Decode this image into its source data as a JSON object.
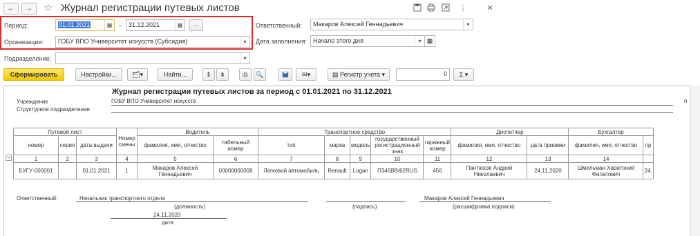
{
  "window": {
    "title": "Журнал регистрации путевых листов",
    "back_icon": "←",
    "forward_icon": "→",
    "star_icon": "☆",
    "top_icons": [
      "save-icon",
      "print-icon",
      "link-icon",
      "more-icon",
      "close-icon"
    ]
  },
  "filters": {
    "period_label": "Период:",
    "period_from": "01.01.2021",
    "period_dash": "–",
    "period_to": "31.12.2021",
    "period_more": "...",
    "org_label": "Организация:",
    "org_value": "ГОБУ ВПО Университет искусств (Субсидия)",
    "dept_label": "Подразделение:",
    "dept_value": "",
    "responsible_label": "Ответственный:",
    "responsible_value": "Макаров Алексей Геннадьевич",
    "fill_date_label": "Дата заполнения:",
    "fill_date_value": "Начало этого дня"
  },
  "toolbar": {
    "generate": "Сформировать",
    "settings": "Настройки...",
    "find": "Найти...",
    "registry": "Регистр учета",
    "number_value": "0",
    "sum_icon": "Σ"
  },
  "report": {
    "heading": "Журнал регистрации путевых листов за период с 01.01.2021 по 31.12.2021",
    "institution_label": "Учреждение",
    "institution_value": "ГОБУ ВПО Университет искусств",
    "structural_label": "Структурное подразделение",
    "right_edge_text": "п",
    "group_headers": [
      "Путевой лист",
      "Номер смены",
      "Водитель",
      "Транспортное средство",
      "Диспетчер",
      "Бухгалтер"
    ],
    "columns": [
      "номер",
      "серия",
      "дата выдачи",
      "",
      "фамилия, имя, отчество",
      "табельный номер",
      "тип",
      "марка",
      "модель",
      "государственный регистрационный знак",
      "гаражный номер",
      "фамилия, имя, отчество",
      "дата приемки",
      "фамилия, имя, отчество",
      "пр"
    ],
    "column_numbers": [
      "1",
      "2",
      "3",
      "4",
      "5",
      "6",
      "7",
      "8",
      "9",
      "10",
      "11",
      "12",
      "13",
      "14",
      ""
    ],
    "rows": [
      [
        "БУГУ-000001",
        "",
        "01.01.2021",
        "1",
        "Макаров Алексей Геннадьевич",
        "00000000008",
        "Легковой автомобиль",
        "Renault",
        "Logan",
        "П345ВВ/62RUS",
        "456",
        "Пантюхов Андрей Николаевич",
        "24.11.2020",
        "Шмельман Харитоний Филатович",
        "24."
      ]
    ],
    "footer": {
      "responsible_label": "Ответственный:",
      "position_value": "Начальник транспортного отдела",
      "position_caption": "(должность)",
      "signature_caption": "(подпись)",
      "name_value": "Макаров Алексей Геннадьевич",
      "name_caption": "(расшифровка подписи)",
      "date_value": "24.11.2020",
      "date_caption": "дата"
    }
  }
}
